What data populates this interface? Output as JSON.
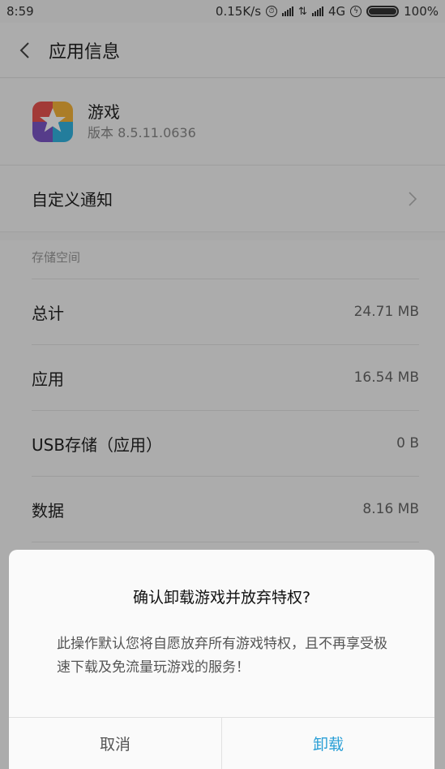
{
  "status_bar": {
    "time": "8:59",
    "net_speed": "0.15K/s",
    "network": "4G",
    "battery": "100%"
  },
  "header": {
    "title": "应用信息"
  },
  "app": {
    "name": "游戏",
    "version": "版本 8.5.11.0636"
  },
  "notification_row": {
    "label": "自定义通知"
  },
  "storage": {
    "section_label": "存储空间",
    "rows": [
      {
        "label": "总计",
        "value": "24.71 MB"
      },
      {
        "label": "应用",
        "value": "16.54 MB"
      },
      {
        "label": "USB存储（应用）",
        "value": "0 B"
      },
      {
        "label": "数据",
        "value": "8.16 MB"
      }
    ]
  },
  "dialog": {
    "title": "确认卸载游戏并放弃特权?",
    "message": "此操作默认您将自愿放弃所有游戏特权，且不再享受极速下载及免流量玩游戏的服务！",
    "cancel_label": "取消",
    "confirm_label": "卸载"
  },
  "colors": {
    "accent": "#2a9fd6",
    "dialog_bg": "#fafafa",
    "page_bg": "#f7f7f7"
  }
}
